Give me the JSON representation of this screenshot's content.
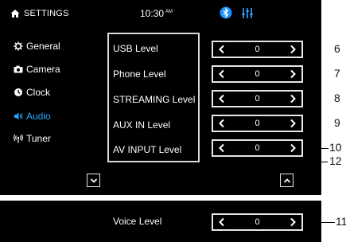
{
  "header": {
    "title": "SETTINGS",
    "time": "10:30",
    "ampm": "AM"
  },
  "menu": [
    {
      "label": "General",
      "icon": "gear-icon"
    },
    {
      "label": "Camera",
      "icon": "camera-icon"
    },
    {
      "label": "Clock",
      "icon": "clock-icon"
    },
    {
      "label": "Audio",
      "icon": "speaker-icon",
      "active": true
    },
    {
      "label": "Tuner",
      "icon": "antenna-icon"
    }
  ],
  "levels": [
    {
      "label": "USB Level",
      "value": "0",
      "callout": "6"
    },
    {
      "label": "Phone Level",
      "value": "0",
      "callout": "7"
    },
    {
      "label": "STREAMING Level",
      "value": "0",
      "callout": "8"
    },
    {
      "label": "AUX IN Level",
      "value": "0",
      "callout": "9"
    },
    {
      "label": "AV INPUT Level",
      "value": "0",
      "callout": "10"
    }
  ],
  "box_callout": "12",
  "voice": {
    "label": "Voice Level",
    "value": "0",
    "callout": "11"
  },
  "colors": {
    "active": "#29a6ff",
    "bluetooth": "#1e90ff",
    "equalizer": "#3aa0ff"
  }
}
